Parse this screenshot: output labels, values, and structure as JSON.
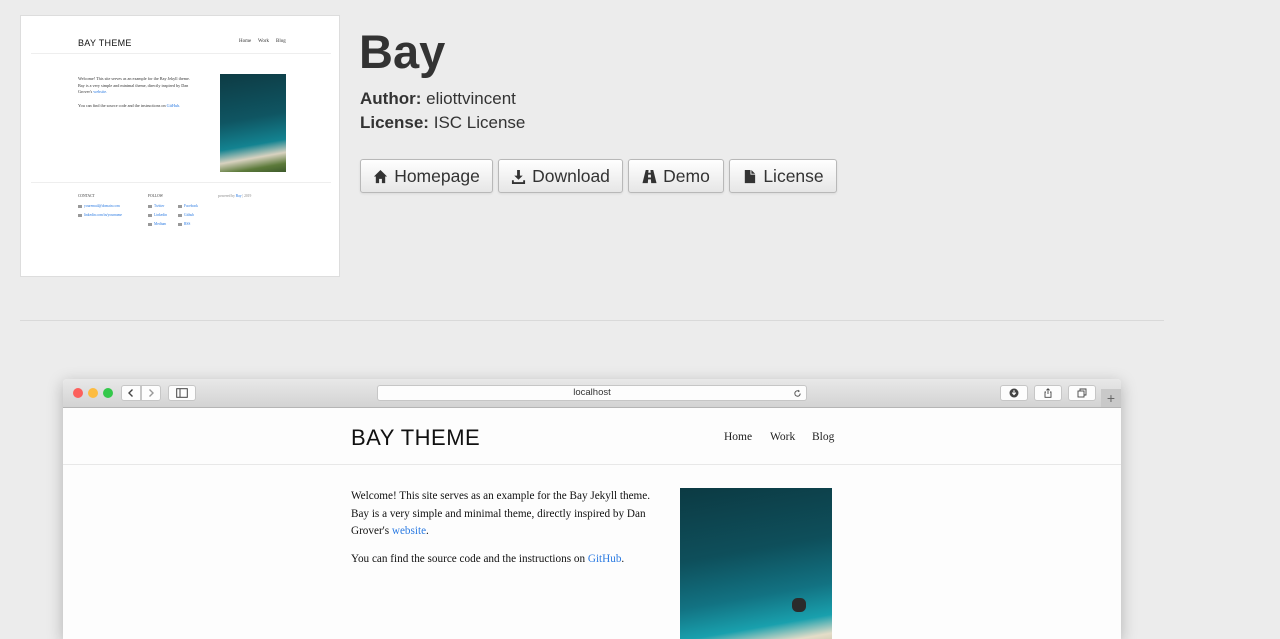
{
  "theme": {
    "title": "Bay",
    "author_label": "Author:",
    "author": "eliottvincent",
    "license_label": "License:",
    "license": "ISC License"
  },
  "buttons": {
    "homepage": {
      "label": "Homepage",
      "icon": "home-icon"
    },
    "download": {
      "label": "Download",
      "icon": "download-icon"
    },
    "demo": {
      "label": "Demo",
      "icon": "road-icon"
    },
    "license": {
      "label": "License",
      "icon": "file-icon"
    }
  },
  "thumbnail": {
    "brand": "BAY THEME",
    "nav": [
      "Home",
      "Work",
      "Blog"
    ],
    "intro_line1": "Welcome! This site serves as an example for the Bay Jekyll theme.",
    "intro_line2": "Bay is a very simple and minimal theme, directly inspired by Dan",
    "intro_line3_pre": "Grover's ",
    "intro_link": "website.",
    "source_pre": "You can find the source code and the instructions on ",
    "source_link": "GitHub.",
    "contact_heading": "CONTACT",
    "contact_items": [
      "youremail@domain.com",
      "linkedin.com/in/yourname"
    ],
    "follow_heading": "FOLLOW",
    "follow_items_col1": [
      "Twitter",
      "Linkedin",
      "Medium"
    ],
    "follow_items_col2": [
      "Facebook",
      "Github",
      "RSS"
    ],
    "powered_pre": "powered by ",
    "powered_link": "Bay",
    "powered_post": " | 2019"
  },
  "browser": {
    "url": "localhost",
    "new_tab": "+"
  },
  "site": {
    "brand": "BAY THEME",
    "nav": [
      "Home",
      "Work",
      "Blog"
    ],
    "intro_line1": "Welcome! This site serves as an example for the Bay Jekyll theme.",
    "intro_line2": "Bay is a very simple and minimal theme, directly inspired by Dan",
    "intro_line3_pre": "Grover's ",
    "intro_link": "website",
    "intro_line3_post": ".",
    "source_pre": "You can find the source code and the instructions on ",
    "source_link": "GitHub",
    "source_post": "."
  },
  "colors": {
    "background": "#ececec",
    "link": "#2a7ae2",
    "traffic_red": "#fc605c",
    "traffic_yellow": "#fdbc40",
    "traffic_green": "#34c84a"
  }
}
